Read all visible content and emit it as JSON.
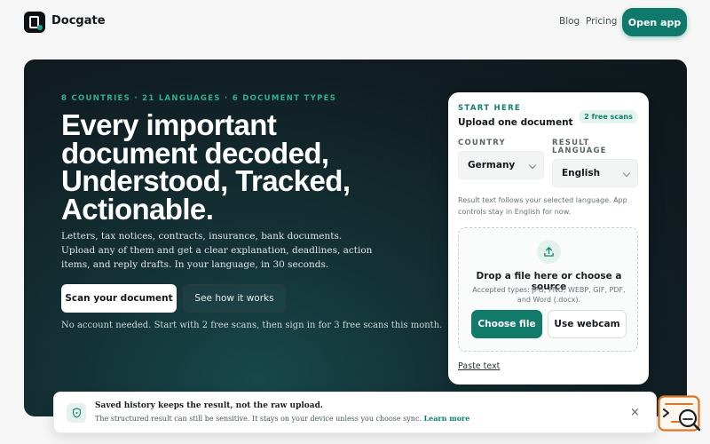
{
  "nav": {
    "brand": "Docgate",
    "links": [
      "Blog",
      "Pricing"
    ],
    "cta": "Open app"
  },
  "hero": {
    "eyebrow": "8 COUNTRIES · 21 LANGUAGES · 6 DOCUMENT TYPES",
    "headline_lines": [
      "Every important",
      "document decoded,",
      "Understood, Tracked,",
      "Actionable."
    ],
    "subtext": "Letters, tax notices, contracts, insurance, bank documents. Upload any of them and get a clear explanation, deadlines, action items, and reply drafts. In your language, in 30 seconds.",
    "primary_button": "Scan your document",
    "secondary_button": "See how it works",
    "note": "No account needed. Start with 2 free scans, then sign in for 3 free scans this month."
  },
  "upload_card": {
    "kicker": "START HERE",
    "title": "Upload one document",
    "badge": "2 free scans",
    "country_label": "COUNTRY",
    "country_value": "Germany",
    "language_label": "RESULT LANGUAGE",
    "language_value": "English",
    "helper": "Result text follows your selected language. App controls stay in English for now.",
    "drop_title": "Drop a file here or choose a source",
    "drop_types": "Accepted types: JPG, PNG, WEBP, GIF, PDF, and Word (.docx).",
    "choose_button": "Choose file",
    "webcam_button": "Use webcam",
    "paste_link": "Paste text"
  },
  "toast": {
    "title": "Saved history keeps the result, not the raw upload.",
    "body": "The structured result can still be sensitive. It stays on your device unless you choose sync.",
    "link": "Learn more",
    "close": "×"
  },
  "colors": {
    "accent": "#0f7a6b",
    "hero_dark": "#101d22",
    "eyebrow": "#2fae90"
  }
}
